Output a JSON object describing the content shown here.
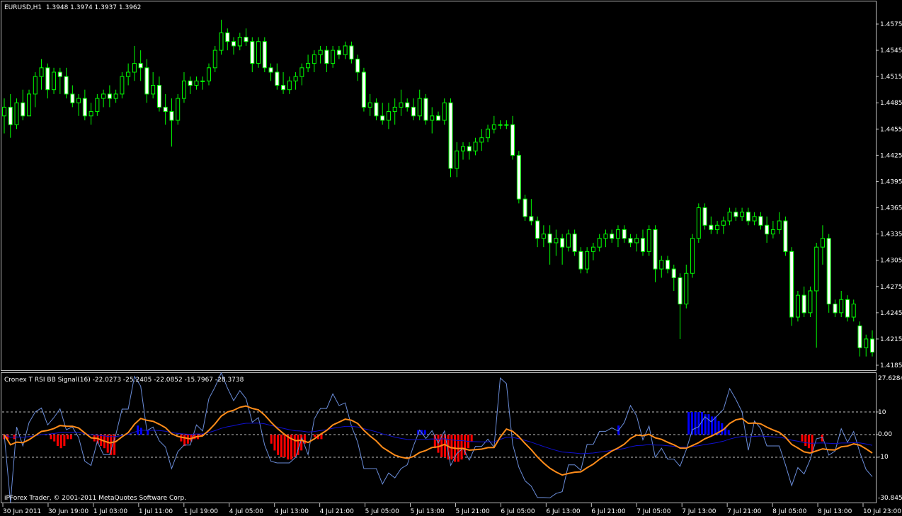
{
  "main_pane": {
    "header": "EURUSD,H1  1.3948 1.3974 1.3937 1.3962",
    "price_labels": [
      "1.4575",
      "1.4545",
      "1.4515",
      "1.4485",
      "1.4455",
      "1.4425",
      "1.4395",
      "1.4365",
      "1.4335",
      "1.4305",
      "1.4275",
      "1.4245",
      "1.4215",
      "1.4185"
    ],
    "candle_color": "#00ff00",
    "bull_body_color": "#000000",
    "bear_body_color": "#ffffff"
  },
  "indicator_pane": {
    "header": "Cronex T RSI BB Signal(16) -22.0273 -25.2405 -22.0852 -15.7967 -28.3738",
    "top_value": "27.6284",
    "bottom_value": "-30.845",
    "level_labels": [
      "10",
      "0.00",
      "-10"
    ],
    "footer": "iPForex Trader, © 2001-2011 MetaQuotes Software Corp.",
    "colors": {
      "positive_hist": "#0000ff",
      "negative_hist": "#ff0000",
      "signal": "#ff8c1a",
      "bb_line": "#1010d0",
      "rsi_line": "#6a8cd8"
    }
  },
  "time_labels": [
    "30 Jun 2011",
    "30 Jun 19:00",
    "1 Jul 03:00",
    "1 Jul 11:00",
    "1 Jul 19:00",
    "4 Jul 05:00",
    "4 Jul 13:00",
    "4 Jul 21:00",
    "5 Jul 05:00",
    "5 Jul 13:00",
    "5 Jul 21:00",
    "6 Jul 05:00",
    "6 Jul 13:00",
    "6 Jul 21:00",
    "7 Jul 05:00",
    "7 Jul 13:00",
    "7 Jul 21:00",
    "8 Jul 05:00",
    "8 Jul 13:00",
    "10 Jul 23:00"
  ],
  "chart_data": {
    "type": "candlestick",
    "symbol": "EURUSD",
    "timeframe": "H1",
    "ylim": [
      1.4175,
      1.459
    ],
    "candles": [
      [
        1.447,
        1.449,
        1.445,
        1.448
      ],
      [
        1.448,
        1.4495,
        1.4445,
        1.446
      ],
      [
        1.446,
        1.449,
        1.4455,
        1.4485
      ],
      [
        1.4485,
        1.45,
        1.4465,
        1.447
      ],
      [
        1.447,
        1.45,
        1.447,
        1.4495
      ],
      [
        1.4495,
        1.452,
        1.448,
        1.4515
      ],
      [
        1.4515,
        1.4535,
        1.45,
        1.4525
      ],
      [
        1.4525,
        1.453,
        1.449,
        1.45
      ],
      [
        1.45,
        1.4525,
        1.4495,
        1.452
      ],
      [
        1.452,
        1.4525,
        1.4495,
        1.4515
      ],
      [
        1.4515,
        1.4525,
        1.449,
        1.4495
      ],
      [
        1.4495,
        1.4505,
        1.448,
        1.4485
      ],
      [
        1.4485,
        1.4495,
        1.447,
        1.449
      ],
      [
        1.449,
        1.45,
        1.4465,
        1.447
      ],
      [
        1.447,
        1.4485,
        1.446,
        1.4475
      ],
      [
        1.4475,
        1.4495,
        1.447,
        1.449
      ],
      [
        1.449,
        1.45,
        1.448,
        1.4495
      ],
      [
        1.4495,
        1.4505,
        1.448,
        1.449
      ],
      [
        1.449,
        1.45,
        1.4485,
        1.4495
      ],
      [
        1.4495,
        1.452,
        1.449,
        1.4515
      ],
      [
        1.4515,
        1.453,
        1.4505,
        1.452
      ],
      [
        1.452,
        1.455,
        1.451,
        1.453
      ],
      [
        1.453,
        1.4545,
        1.451,
        1.4525
      ],
      [
        1.4525,
        1.4535,
        1.4485,
        1.4495
      ],
      [
        1.4495,
        1.452,
        1.449,
        1.4505
      ],
      [
        1.4505,
        1.4515,
        1.4475,
        1.448
      ],
      [
        1.448,
        1.4495,
        1.446,
        1.4475
      ],
      [
        1.4475,
        1.449,
        1.4435,
        1.4465
      ],
      [
        1.4465,
        1.4495,
        1.446,
        1.449
      ],
      [
        1.449,
        1.452,
        1.4485,
        1.451
      ],
      [
        1.451,
        1.4515,
        1.4495,
        1.4505
      ],
      [
        1.4505,
        1.4515,
        1.45,
        1.451
      ],
      [
        1.451,
        1.4515,
        1.45,
        1.451
      ],
      [
        1.451,
        1.453,
        1.4505,
        1.4525
      ],
      [
        1.4525,
        1.455,
        1.452,
        1.4545
      ],
      [
        1.4545,
        1.458,
        1.454,
        1.4565
      ],
      [
        1.4565,
        1.457,
        1.4545,
        1.4555
      ],
      [
        1.4555,
        1.456,
        1.454,
        1.455
      ],
      [
        1.455,
        1.4565,
        1.4545,
        1.456
      ],
      [
        1.456,
        1.457,
        1.455,
        1.4555
      ],
      [
        1.4555,
        1.456,
        1.452,
        1.453
      ],
      [
        1.453,
        1.456,
        1.4525,
        1.4555
      ],
      [
        1.4555,
        1.456,
        1.452,
        1.4525
      ],
      [
        1.4525,
        1.453,
        1.451,
        1.452
      ],
      [
        1.452,
        1.453,
        1.45,
        1.4505
      ],
      [
        1.4505,
        1.452,
        1.4495,
        1.45
      ],
      [
        1.45,
        1.4515,
        1.4495,
        1.451
      ],
      [
        1.451,
        1.452,
        1.45,
        1.4515
      ],
      [
        1.4515,
        1.453,
        1.4505,
        1.4525
      ],
      [
        1.4525,
        1.454,
        1.452,
        1.453
      ],
      [
        1.453,
        1.4545,
        1.452,
        1.454
      ],
      [
        1.454,
        1.455,
        1.453,
        1.4545
      ],
      [
        1.4545,
        1.455,
        1.452,
        1.453
      ],
      [
        1.453,
        1.455,
        1.4525,
        1.4545
      ],
      [
        1.4545,
        1.455,
        1.4535,
        1.454
      ],
      [
        1.454,
        1.4555,
        1.4535,
        1.455
      ],
      [
        1.455,
        1.4555,
        1.453,
        1.4535
      ],
      [
        1.4535,
        1.454,
        1.451,
        1.452
      ],
      [
        1.452,
        1.4525,
        1.4475,
        1.448
      ],
      [
        1.448,
        1.4495,
        1.447,
        1.4485
      ],
      [
        1.4485,
        1.449,
        1.4465,
        1.447
      ],
      [
        1.447,
        1.4485,
        1.446,
        1.4465
      ],
      [
        1.4465,
        1.4485,
        1.4455,
        1.4475
      ],
      [
        1.4475,
        1.449,
        1.446,
        1.448
      ],
      [
        1.448,
        1.45,
        1.447,
        1.4485
      ],
      [
        1.4485,
        1.449,
        1.4475,
        1.448
      ],
      [
        1.448,
        1.449,
        1.4465,
        1.447
      ],
      [
        1.447,
        1.45,
        1.4465,
        1.449
      ],
      [
        1.449,
        1.4495,
        1.446,
        1.4465
      ],
      [
        1.4465,
        1.448,
        1.445,
        1.447
      ],
      [
        1.447,
        1.4475,
        1.4465,
        1.4465
      ],
      [
        1.4465,
        1.449,
        1.446,
        1.4485
      ],
      [
        1.4485,
        1.449,
        1.44,
        1.441
      ],
      [
        1.441,
        1.444,
        1.44,
        1.443
      ],
      [
        1.443,
        1.444,
        1.442,
        1.4435
      ],
      [
        1.4435,
        1.444,
        1.442,
        1.443
      ],
      [
        1.443,
        1.4445,
        1.4425,
        1.444
      ],
      [
        1.444,
        1.4455,
        1.443,
        1.4445
      ],
      [
        1.4445,
        1.446,
        1.444,
        1.4455
      ],
      [
        1.4455,
        1.447,
        1.445,
        1.446
      ],
      [
        1.446,
        1.4465,
        1.4455,
        1.446
      ],
      [
        1.446,
        1.4465,
        1.4455,
        1.446
      ],
      [
        1.446,
        1.447,
        1.442,
        1.4425
      ],
      [
        1.4425,
        1.443,
        1.437,
        1.4375
      ],
      [
        1.4375,
        1.438,
        1.435,
        1.4355
      ],
      [
        1.4355,
        1.4375,
        1.4345,
        1.435
      ],
      [
        1.435,
        1.4355,
        1.432,
        1.433
      ],
      [
        1.433,
        1.4345,
        1.432,
        1.4335
      ],
      [
        1.4335,
        1.4345,
        1.43,
        1.4325
      ],
      [
        1.4325,
        1.434,
        1.431,
        1.433
      ],
      [
        1.433,
        1.4335,
        1.43,
        1.432
      ],
      [
        1.432,
        1.434,
        1.4315,
        1.4335
      ],
      [
        1.4335,
        1.434,
        1.431,
        1.4315
      ],
      [
        1.4315,
        1.432,
        1.429,
        1.4295
      ],
      [
        1.4295,
        1.432,
        1.429,
        1.4315
      ],
      [
        1.4315,
        1.4325,
        1.4305,
        1.432
      ],
      [
        1.432,
        1.4335,
        1.4315,
        1.433
      ],
      [
        1.433,
        1.434,
        1.432,
        1.4335
      ],
      [
        1.4335,
        1.434,
        1.4325,
        1.433
      ],
      [
        1.433,
        1.4345,
        1.432,
        1.434
      ],
      [
        1.434,
        1.4345,
        1.4325,
        1.433
      ],
      [
        1.433,
        1.4335,
        1.432,
        1.4325
      ],
      [
        1.4325,
        1.4335,
        1.4315,
        1.433
      ],
      [
        1.433,
        1.434,
        1.431,
        1.4315
      ],
      [
        1.4315,
        1.4345,
        1.431,
        1.434
      ],
      [
        1.434,
        1.4345,
        1.428,
        1.4295
      ],
      [
        1.4295,
        1.431,
        1.4285,
        1.4305
      ],
      [
        1.4305,
        1.431,
        1.429,
        1.4295
      ],
      [
        1.4295,
        1.43,
        1.427,
        1.4285
      ],
      [
        1.4285,
        1.429,
        1.4215,
        1.4255
      ],
      [
        1.4255,
        1.43,
        1.425,
        1.429
      ],
      [
        1.429,
        1.4335,
        1.4285,
        1.433
      ],
      [
        1.433,
        1.437,
        1.4325,
        1.4365
      ],
      [
        1.4365,
        1.437,
        1.434,
        1.4345
      ],
      [
        1.4345,
        1.4355,
        1.4335,
        1.434
      ],
      [
        1.434,
        1.435,
        1.4335,
        1.4345
      ],
      [
        1.4345,
        1.4355,
        1.4335,
        1.435
      ],
      [
        1.435,
        1.4365,
        1.4345,
        1.436
      ],
      [
        1.436,
        1.4365,
        1.435,
        1.4355
      ],
      [
        1.4355,
        1.4365,
        1.435,
        1.436
      ],
      [
        1.436,
        1.4365,
        1.4345,
        1.435
      ],
      [
        1.435,
        1.436,
        1.4345,
        1.4355
      ],
      [
        1.4355,
        1.436,
        1.434,
        1.4345
      ],
      [
        1.4345,
        1.4355,
        1.4325,
        1.4335
      ],
      [
        1.4335,
        1.435,
        1.433,
        1.434
      ],
      [
        1.434,
        1.436,
        1.4335,
        1.435
      ],
      [
        1.435,
        1.4355,
        1.431,
        1.4315
      ],
      [
        1.4315,
        1.432,
        1.423,
        1.424
      ],
      [
        1.424,
        1.427,
        1.4235,
        1.4265
      ],
      [
        1.4265,
        1.4275,
        1.424,
        1.4245
      ],
      [
        1.4245,
        1.4275,
        1.424,
        1.427
      ],
      [
        1.427,
        1.4325,
        1.4205,
        1.432
      ],
      [
        1.432,
        1.4345,
        1.43,
        1.433
      ],
      [
        1.433,
        1.4335,
        1.4245,
        1.4255
      ],
      [
        1.4255,
        1.426,
        1.424,
        1.4245
      ],
      [
        1.4245,
        1.427,
        1.424,
        1.426
      ],
      [
        1.426,
        1.4265,
        1.4235,
        1.424
      ],
      [
        1.424,
        1.426,
        1.4235,
        1.4255
      ],
      [
        1.423,
        1.4235,
        1.4195,
        1.4205
      ],
      [
        1.4205,
        1.422,
        1.4195,
        1.4215
      ],
      [
        1.4215,
        1.4225,
        1.4195,
        1.42
      ]
    ],
    "rsi_pane": {
      "levels": [
        10,
        0,
        -10
      ],
      "ylim": [
        -30.845,
        27.6284
      ],
      "histogram": [
        -2,
        -2,
        0,
        -2,
        0,
        0,
        0,
        0,
        0,
        0,
        0,
        0,
        0,
        0,
        -2,
        -3,
        -5,
        -6,
        -5,
        -2,
        -2,
        0,
        0,
        0,
        0,
        0,
        0,
        -3,
        -4,
        -5,
        -6,
        -8,
        -9,
        -9,
        0,
        0,
        0,
        0,
        0,
        0,
        4,
        3,
        0,
        2,
        0,
        0,
        0,
        0,
        0,
        0,
        0,
        0,
        0,
        -3,
        -5,
        -4,
        -3,
        -2,
        -2,
        -1,
        0,
        0,
        0,
        0,
        0,
        0,
        0,
        0,
        0,
        0,
        0,
        0,
        0,
        0,
        0,
        0,
        0,
        0,
        0,
        0,
        -4,
        -7,
        -9,
        -10,
        -10,
        -11,
        -11,
        -10,
        -9,
        -7,
        -4,
        0,
        0,
        -1,
        -2,
        -2,
        0,
        0,
        0,
        0,
        0,
        0,
        0,
        0,
        0,
        0,
        0,
        0,
        0,
        0,
        0,
        0,
        0,
        0,
        0,
        0,
        0,
        0,
        0,
        0,
        0,
        0,
        0,
        0,
        2,
        2,
        2,
        0,
        0,
        -6,
        -8,
        -10,
        -10,
        -11,
        -11,
        -12,
        -12,
        -11,
        -9,
        -6,
        -3,
        0,
        0,
        0,
        0,
        0,
        0,
        0,
        0,
        0,
        0,
        0,
        0,
        0,
        0,
        0,
        0,
        0,
        0,
        0,
        0,
        0,
        0,
        0,
        0,
        0,
        0,
        0,
        0,
        0,
        0,
        0,
        0,
        0,
        0,
        0,
        0,
        0,
        0,
        0,
        0,
        0,
        0,
        0,
        4,
        0,
        0,
        0,
        0,
        0,
        0,
        0,
        0,
        0,
        0,
        0,
        0,
        0,
        0,
        0,
        0,
        0,
        0,
        0,
        0,
        10,
        10,
        10,
        10,
        10,
        9,
        9,
        8,
        8,
        6,
        5,
        3,
        2,
        0,
        0,
        0,
        0,
        0,
        0,
        0,
        0,
        0,
        0,
        0,
        0,
        0,
        0,
        0,
        0,
        0,
        0,
        0,
        0,
        0,
        -3,
        -5,
        -6,
        -8,
        0,
        0,
        -3,
        0,
        0,
        0,
        0,
        0,
        0,
        0,
        0,
        0,
        0,
        0,
        0,
        0,
        0,
        0
      ]
    }
  }
}
